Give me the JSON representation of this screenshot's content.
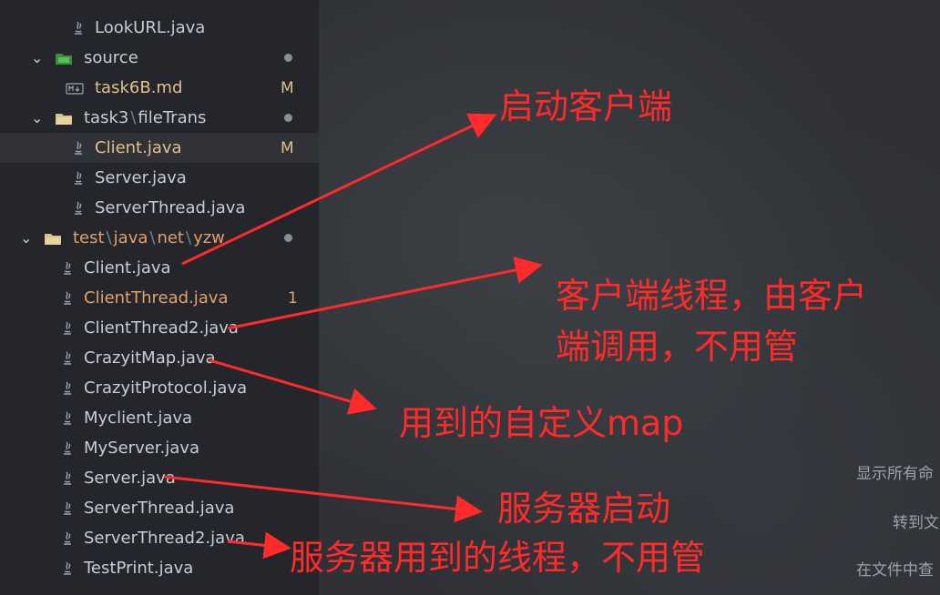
{
  "explorer": {
    "items": [
      {
        "label": "LookURL.java",
        "badge": ""
      },
      {
        "label": "source",
        "badge": ""
      },
      {
        "label": "task6B.md",
        "badge": "M"
      },
      {
        "label": "task3",
        "label2": "fileTrans",
        "badge": ""
      },
      {
        "label": "Client.java",
        "badge": "M"
      },
      {
        "label": "Server.java",
        "badge": ""
      },
      {
        "label": "ServerThread.java",
        "badge": ""
      },
      {
        "label": "test",
        "label2": "java",
        "label3": "net",
        "label4": "yzw",
        "badge": ""
      },
      {
        "label": "Client.java",
        "badge": ""
      },
      {
        "label": "ClientThread.java",
        "badge": "1"
      },
      {
        "label": "ClientThread2.java",
        "badge": ""
      },
      {
        "label": "CrazyitMap.java",
        "badge": ""
      },
      {
        "label": "CrazyitProtocol.java",
        "badge": ""
      },
      {
        "label": "Myclient.java",
        "badge": ""
      },
      {
        "label": "MyServer.java",
        "badge": ""
      },
      {
        "label": "Server.java",
        "badge": ""
      },
      {
        "label": "ServerThread.java",
        "badge": ""
      },
      {
        "label": "ServerThread2.java",
        "badge": ""
      },
      {
        "label": "TestPrint.java",
        "badge": ""
      }
    ]
  },
  "annotations": {
    "start_client": "启动客户端",
    "client_thread_1": "客户端线程，由客户",
    "client_thread_2": "端调用，不用管",
    "custom_map": "用到的自定义map",
    "server_start": "服务器启动",
    "server_thread": "服务器用到的线程，不用管"
  },
  "menu_hints": {
    "show_all": "显示所有命",
    "goto": "转到文",
    "find_in_files": "在文件中查"
  },
  "colors": {
    "annotation": "#ff2a2a",
    "modified_file": "#e2c08d",
    "problem_file": "#e2a16c"
  }
}
